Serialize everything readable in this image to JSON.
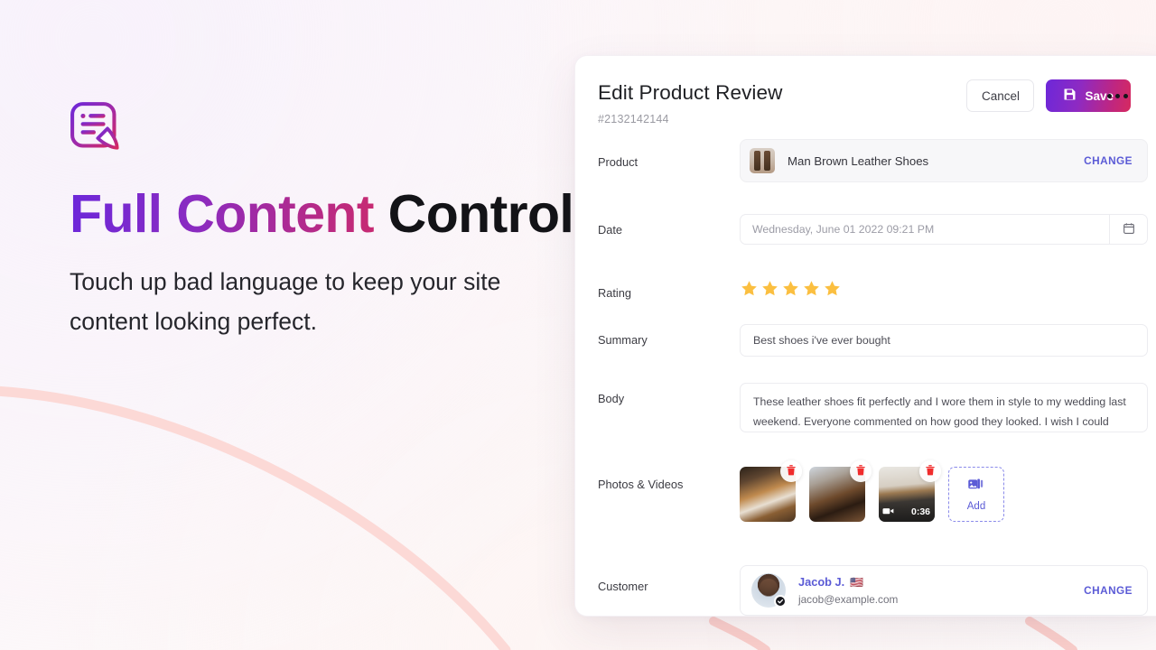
{
  "hero": {
    "icon": "document-edit-icon",
    "title_accent": "Full Content",
    "title_plain": " Control",
    "subtitle": "Touch up bad language to keep your site content looking perfect.",
    "accent_from": "#6d28d9",
    "accent_to": "#c72a72"
  },
  "card": {
    "title": "Edit Product Review",
    "subtitle": "#2132142144",
    "actions": {
      "cancel_label": "Cancel",
      "save_label": "Save",
      "save_icon": "save-disk-icon",
      "more_icon": "ellipsis-icon"
    },
    "labels": {
      "product": "Product",
      "date": "Date",
      "rating": "Rating",
      "summary": "Summary",
      "body": "Body",
      "photos": "Photos & Videos",
      "customer": "Customer"
    },
    "product": {
      "name": "Man Brown Leather Shoes",
      "change_label": "CHANGE",
      "thumb_alt": "product-thumbnail"
    },
    "date": {
      "value": "Wednesday, June 01 2022 09:21 PM",
      "placeholder": "Wednesday, June 01 2022 09:21 PM",
      "calendar_icon": "calendar-icon"
    },
    "rating": {
      "value": 5,
      "max": 5,
      "star_color": "#fbbf40"
    },
    "summary": {
      "value": "Best shoes i've ever bought",
      "placeholder": "Summary"
    },
    "body": {
      "value": "These leather shoes fit perfectly and I wore them in style to my wedding last weekend. Everyone commented on how good they looked. I wish I could wear them more often,...",
      "placeholder": "Body"
    },
    "media": [
      {
        "name": "shoes-on-table-photo",
        "type": "photo",
        "delete_icon": "trash-icon"
      },
      {
        "name": "shoes-closeup-photo",
        "type": "photo",
        "delete_icon": "trash-icon"
      },
      {
        "name": "shoes-worn-video",
        "type": "video",
        "duration": "0:36",
        "video_icon": "video-camera-icon",
        "delete_icon": "trash-icon"
      }
    ],
    "add_media": {
      "label": "Add",
      "icon": "add-photos-icon",
      "accent": "#5b5bd6"
    },
    "customer": {
      "name": "Jacob J.",
      "flag": "🇺🇸",
      "email": "jacob@example.com",
      "change_label": "CHANGE",
      "verified_icon": "verified-check-icon",
      "avatar_alt": "customer-avatar"
    }
  }
}
